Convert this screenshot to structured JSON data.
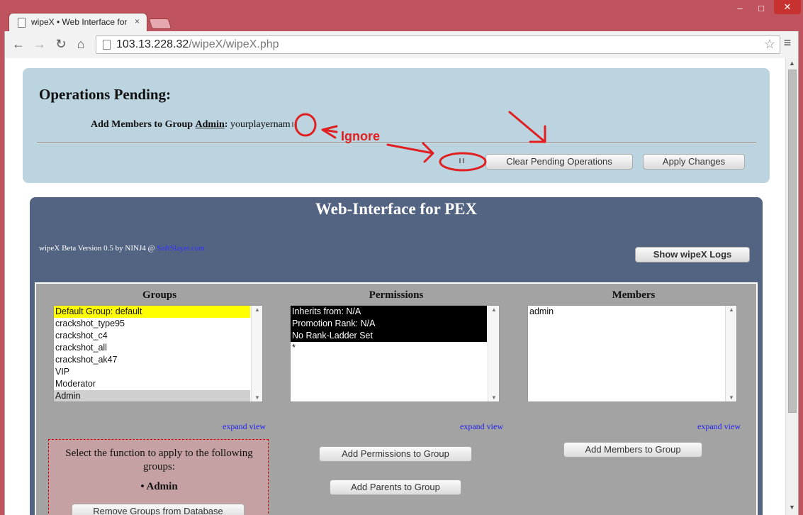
{
  "browser": {
    "tab_title": "wipeX • Web Interface for",
    "tab_close": "×",
    "window_min": "–",
    "window_max": "□",
    "window_close": "✕",
    "nav_back": "←",
    "nav_forward": "→",
    "nav_reload": "↻",
    "nav_home": "⌂",
    "url_host": "103.13.228.32",
    "url_path": "/wipeX/wipeX.php",
    "star": "☆",
    "menu": "≡"
  },
  "pending": {
    "title": "Operations Pending:",
    "op_prefix": "Add Members to Group",
    "op_group": "Admin",
    "op_colon": ":",
    "op_value": "yourplayernam",
    "clear_button": "Clear Pending Operations",
    "apply_button": "Apply Changes"
  },
  "annotation": {
    "ignore_label": "Ignore",
    "color": "#e02020"
  },
  "main": {
    "title": "Web-Interface for PEX",
    "version_text": "wipeX Beta Version 0.5 by NINJ4 @",
    "version_link": "SoftSlayer.com",
    "logs_button": "Show wipeX Logs"
  },
  "groups": {
    "header": "Groups",
    "items": [
      "Default Group: default",
      "crackshot_type95",
      "crackshot_c4",
      "crackshot_all",
      "crackshot_ak47",
      "VIP",
      "Moderator",
      "Admin"
    ],
    "expand": "expand view"
  },
  "permissions": {
    "header": "Permissions",
    "items": [
      "Inherits from: N/A",
      "Promotion Rank: N/A",
      "No Rank-Ladder Set",
      "*"
    ],
    "expand": "expand view",
    "add_perm_button": "Add Permissions to Group",
    "add_parents_button": "Add Parents to Group"
  },
  "members": {
    "header": "Members",
    "items": [
      "admin"
    ],
    "expand": "expand view",
    "add_button": "Add Members to Group"
  },
  "function_box": {
    "text": "Select the function to apply to the following groups:",
    "group": "• Admin",
    "remove_button": "Remove Groups from Database"
  },
  "colors": {
    "chrome": "#c0545e",
    "pending_bg": "#bcd3e0",
    "main_bg": "#536482",
    "inner_bg": "#a3a3a3",
    "highlight_yellow": "#ffff00"
  }
}
